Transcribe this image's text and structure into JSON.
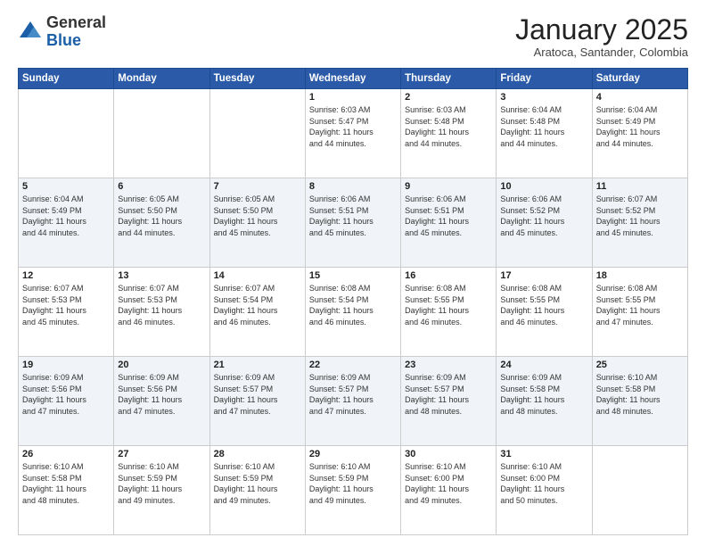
{
  "header": {
    "logo_general": "General",
    "logo_blue": "Blue",
    "month": "January 2025",
    "location": "Aratoca, Santander, Colombia"
  },
  "weekdays": [
    "Sunday",
    "Monday",
    "Tuesday",
    "Wednesday",
    "Thursday",
    "Friday",
    "Saturday"
  ],
  "weeks": [
    [
      {
        "day": "",
        "info": ""
      },
      {
        "day": "",
        "info": ""
      },
      {
        "day": "",
        "info": ""
      },
      {
        "day": "1",
        "info": "Sunrise: 6:03 AM\nSunset: 5:47 PM\nDaylight: 11 hours\nand 44 minutes."
      },
      {
        "day": "2",
        "info": "Sunrise: 6:03 AM\nSunset: 5:48 PM\nDaylight: 11 hours\nand 44 minutes."
      },
      {
        "day": "3",
        "info": "Sunrise: 6:04 AM\nSunset: 5:48 PM\nDaylight: 11 hours\nand 44 minutes."
      },
      {
        "day": "4",
        "info": "Sunrise: 6:04 AM\nSunset: 5:49 PM\nDaylight: 11 hours\nand 44 minutes."
      }
    ],
    [
      {
        "day": "5",
        "info": "Sunrise: 6:04 AM\nSunset: 5:49 PM\nDaylight: 11 hours\nand 44 minutes."
      },
      {
        "day": "6",
        "info": "Sunrise: 6:05 AM\nSunset: 5:50 PM\nDaylight: 11 hours\nand 44 minutes."
      },
      {
        "day": "7",
        "info": "Sunrise: 6:05 AM\nSunset: 5:50 PM\nDaylight: 11 hours\nand 45 minutes."
      },
      {
        "day": "8",
        "info": "Sunrise: 6:06 AM\nSunset: 5:51 PM\nDaylight: 11 hours\nand 45 minutes."
      },
      {
        "day": "9",
        "info": "Sunrise: 6:06 AM\nSunset: 5:51 PM\nDaylight: 11 hours\nand 45 minutes."
      },
      {
        "day": "10",
        "info": "Sunrise: 6:06 AM\nSunset: 5:52 PM\nDaylight: 11 hours\nand 45 minutes."
      },
      {
        "day": "11",
        "info": "Sunrise: 6:07 AM\nSunset: 5:52 PM\nDaylight: 11 hours\nand 45 minutes."
      }
    ],
    [
      {
        "day": "12",
        "info": "Sunrise: 6:07 AM\nSunset: 5:53 PM\nDaylight: 11 hours\nand 45 minutes."
      },
      {
        "day": "13",
        "info": "Sunrise: 6:07 AM\nSunset: 5:53 PM\nDaylight: 11 hours\nand 46 minutes."
      },
      {
        "day": "14",
        "info": "Sunrise: 6:07 AM\nSunset: 5:54 PM\nDaylight: 11 hours\nand 46 minutes."
      },
      {
        "day": "15",
        "info": "Sunrise: 6:08 AM\nSunset: 5:54 PM\nDaylight: 11 hours\nand 46 minutes."
      },
      {
        "day": "16",
        "info": "Sunrise: 6:08 AM\nSunset: 5:55 PM\nDaylight: 11 hours\nand 46 minutes."
      },
      {
        "day": "17",
        "info": "Sunrise: 6:08 AM\nSunset: 5:55 PM\nDaylight: 11 hours\nand 46 minutes."
      },
      {
        "day": "18",
        "info": "Sunrise: 6:08 AM\nSunset: 5:55 PM\nDaylight: 11 hours\nand 47 minutes."
      }
    ],
    [
      {
        "day": "19",
        "info": "Sunrise: 6:09 AM\nSunset: 5:56 PM\nDaylight: 11 hours\nand 47 minutes."
      },
      {
        "day": "20",
        "info": "Sunrise: 6:09 AM\nSunset: 5:56 PM\nDaylight: 11 hours\nand 47 minutes."
      },
      {
        "day": "21",
        "info": "Sunrise: 6:09 AM\nSunset: 5:57 PM\nDaylight: 11 hours\nand 47 minutes."
      },
      {
        "day": "22",
        "info": "Sunrise: 6:09 AM\nSunset: 5:57 PM\nDaylight: 11 hours\nand 47 minutes."
      },
      {
        "day": "23",
        "info": "Sunrise: 6:09 AM\nSunset: 5:57 PM\nDaylight: 11 hours\nand 48 minutes."
      },
      {
        "day": "24",
        "info": "Sunrise: 6:09 AM\nSunset: 5:58 PM\nDaylight: 11 hours\nand 48 minutes."
      },
      {
        "day": "25",
        "info": "Sunrise: 6:10 AM\nSunset: 5:58 PM\nDaylight: 11 hours\nand 48 minutes."
      }
    ],
    [
      {
        "day": "26",
        "info": "Sunrise: 6:10 AM\nSunset: 5:58 PM\nDaylight: 11 hours\nand 48 minutes."
      },
      {
        "day": "27",
        "info": "Sunrise: 6:10 AM\nSunset: 5:59 PM\nDaylight: 11 hours\nand 49 minutes."
      },
      {
        "day": "28",
        "info": "Sunrise: 6:10 AM\nSunset: 5:59 PM\nDaylight: 11 hours\nand 49 minutes."
      },
      {
        "day": "29",
        "info": "Sunrise: 6:10 AM\nSunset: 5:59 PM\nDaylight: 11 hours\nand 49 minutes."
      },
      {
        "day": "30",
        "info": "Sunrise: 6:10 AM\nSunset: 6:00 PM\nDaylight: 11 hours\nand 49 minutes."
      },
      {
        "day": "31",
        "info": "Sunrise: 6:10 AM\nSunset: 6:00 PM\nDaylight: 11 hours\nand 50 minutes."
      },
      {
        "day": "",
        "info": ""
      }
    ]
  ]
}
